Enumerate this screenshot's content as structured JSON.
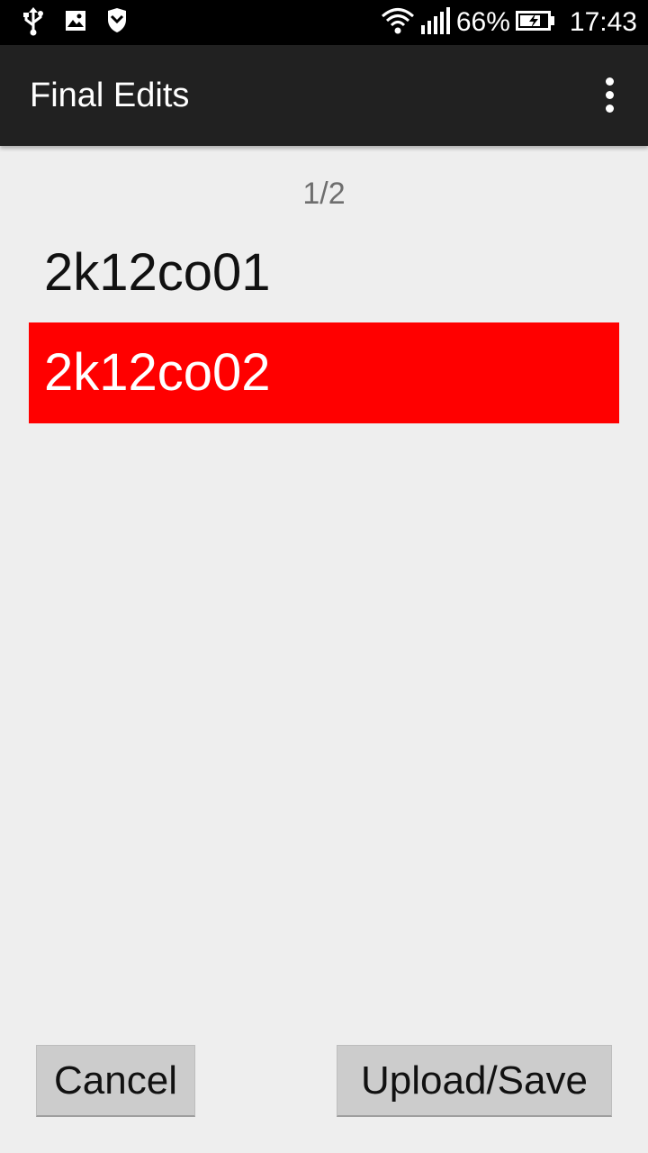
{
  "status_bar": {
    "icons_left": [
      "usb-icon",
      "image-icon",
      "shield-icon"
    ],
    "icons_right": [
      "wifi-icon",
      "signal-icon",
      "battery-charging-icon"
    ],
    "battery": "66%",
    "time": "17:43"
  },
  "action_bar": {
    "title": "Final Edits",
    "overflow_icon": "overflow-menu-icon"
  },
  "content": {
    "page_indicator": "1/2",
    "items": [
      {
        "label": "2k12co01",
        "selected": false
      },
      {
        "label": "2k12co02",
        "selected": true
      }
    ],
    "selected_color": "#ff0000"
  },
  "buttons": {
    "cancel": "Cancel",
    "upload_save": "Upload/Save"
  }
}
